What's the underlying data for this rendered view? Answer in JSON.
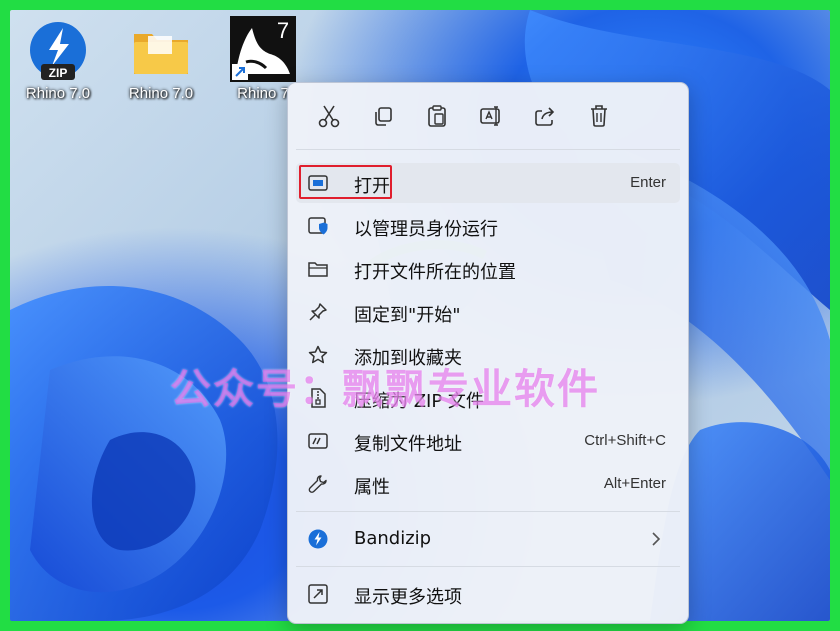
{
  "desktop": {
    "icons": [
      {
        "label": "Rhino 7.0",
        "icon": "zip-archive-icon",
        "badge": "ZIP"
      },
      {
        "label": "Rhino 7.0",
        "icon": "folder-icon"
      },
      {
        "label": "Rhino 7",
        "icon": "rhino-app-shortcut-icon",
        "badge": "7"
      }
    ]
  },
  "context_menu": {
    "toolbar": [
      {
        "name": "cut",
        "icon": "scissors-icon"
      },
      {
        "name": "copy",
        "icon": "copy-icon"
      },
      {
        "name": "paste",
        "icon": "paste-icon"
      },
      {
        "name": "rename",
        "icon": "rename-icon"
      },
      {
        "name": "share",
        "icon": "share-icon"
      },
      {
        "name": "delete",
        "icon": "trash-icon"
      }
    ],
    "items": [
      {
        "label": "打开",
        "shortcut": "Enter",
        "icon": "open-window-icon",
        "highlighted": true
      },
      {
        "label": "以管理员身份运行",
        "shortcut": "",
        "icon": "shield-admin-icon"
      },
      {
        "label": "打开文件所在的位置",
        "shortcut": "",
        "icon": "folder-outline-icon"
      },
      {
        "label": "固定到\"开始\"",
        "shortcut": "",
        "icon": "pin-icon"
      },
      {
        "label": "添加到收藏夹",
        "shortcut": "",
        "icon": "star-icon"
      },
      {
        "label": "压缩为 ZIP 文件",
        "shortcut": "",
        "icon": "zip-file-icon"
      },
      {
        "label": "复制文件地址",
        "shortcut": "Ctrl+Shift+C",
        "icon": "copy-path-icon"
      },
      {
        "label": "属性",
        "shortcut": "Alt+Enter",
        "icon": "wrench-icon"
      }
    ],
    "submenu_item": {
      "label": "Bandizip",
      "icon": "bandizip-icon"
    },
    "more_item": {
      "label": "显示更多选项",
      "icon": "more-options-icon"
    }
  },
  "watermark": {
    "text": "公众号：飘飘专业软件"
  },
  "colors": {
    "highlight_border": "#e01e2d",
    "frame": "#22dd44",
    "bandizip": "#1a6fd8"
  }
}
